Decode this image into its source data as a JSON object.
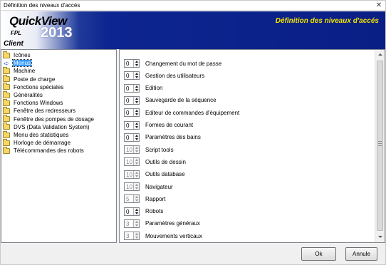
{
  "window": {
    "title": "Définition des niveaux d'accés",
    "close_glyph": "✕"
  },
  "banner": {
    "brand": "QuickView",
    "subbrand": "FPL",
    "year": "2013",
    "client": "Client",
    "heading": "Définition des niveaux d'accés",
    "heading_color": "#f5e400",
    "gradient_dark": "#0a1f86"
  },
  "tree": {
    "selected_color": "#3399ff",
    "items": [
      {
        "label": "Icônes",
        "icon": "folder-icon"
      },
      {
        "label": "Menus",
        "icon": "arrow-icon"
      },
      {
        "label": "Machine",
        "icon": "folder-icon"
      },
      {
        "label": "Poste de charge",
        "icon": "folder-icon"
      },
      {
        "label": "Fonctions spéciales",
        "icon": "folder-icon"
      },
      {
        "label": "Généralités",
        "icon": "folder-icon"
      },
      {
        "label": "Fonctions Windows",
        "icon": "folder-icon"
      },
      {
        "label": "Fenêtre des redresseurs",
        "icon": "folder-icon"
      },
      {
        "label": "Fenêtre des pompes de dosage",
        "icon": "folder-icon"
      },
      {
        "label": "DVS (Data Validation System)",
        "icon": "folder-icon"
      },
      {
        "label": "Menu des statistiques",
        "icon": "folder-icon"
      },
      {
        "label": "Horloge de démarrage",
        "icon": "folder-icon"
      },
      {
        "label": "Télécommandes des robots",
        "icon": "folder-icon"
      }
    ]
  },
  "levels": {
    "rows": [
      {
        "value": "0",
        "label": "Changement du mot de passe"
      },
      {
        "value": "0",
        "label": "Gestion des utilisateurs"
      },
      {
        "value": "0",
        "label": "Edition"
      },
      {
        "value": "0",
        "label": "Sauvegarde de la séquence"
      },
      {
        "value": "0",
        "label": "Editeur de commandes d'équipement"
      },
      {
        "value": "0",
        "label": "Formes de courant"
      },
      {
        "value": "0",
        "label": "Paramètres des bains"
      },
      {
        "value": "10",
        "label": "Script tools"
      },
      {
        "value": "10",
        "label": "Outils de dessin"
      },
      {
        "value": "10",
        "label": "Outils database"
      },
      {
        "value": "10",
        "label": "Navigateur"
      },
      {
        "value": "5",
        "label": "Rapport"
      },
      {
        "value": "0",
        "label": "Robots"
      },
      {
        "value": "3",
        "label": "Paramètres généraux"
      },
      {
        "value": "3",
        "label": "Mouvements verticaux"
      }
    ]
  },
  "buttons": {
    "ok": "Ok",
    "cancel": "Annule"
  }
}
